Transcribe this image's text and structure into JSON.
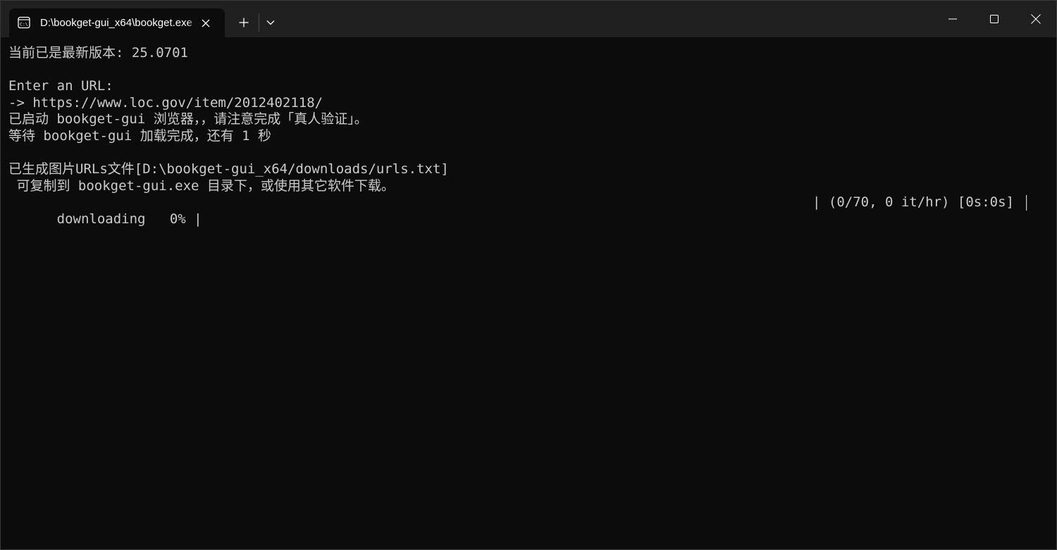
{
  "window": {
    "tab_title": "D:\\bookget-gui_x64\\bookget.exe",
    "tab_icon": "terminal-icon",
    "buttons": {
      "close_tab": "close-icon",
      "new_tab": "plus-icon",
      "dropdown": "chevron-down-icon",
      "minimize": "minimize-icon",
      "maximize": "maximize-icon",
      "close": "close-icon"
    }
  },
  "terminal": {
    "lines": [
      "当前已是最新版本: 25.0701",
      "",
      "Enter an URL:",
      "-> https://www.loc.gov/item/2012402118/",
      "已启动 bookget-gui 浏览器，，请注意完成「真人验证」。",
      "等待 bookget-gui 加载完成，还有 1 秒",
      "",
      "已生成图片URLs文件[D:\\bookget-gui_x64/downloads/urls.txt]",
      " 可复制到 bookget-gui.exe 目录下，或使用其它软件下载。"
    ],
    "progress": {
      "label": "downloading",
      "percent_text": "0%",
      "bar_open": "|",
      "stats": "| (0/70, 0 it/hr) [0s:0s]",
      "fraction": 0.0
    }
  },
  "colors": {
    "background": "#0c0c0c",
    "titlebar": "#202020",
    "text": "#cccccc"
  }
}
